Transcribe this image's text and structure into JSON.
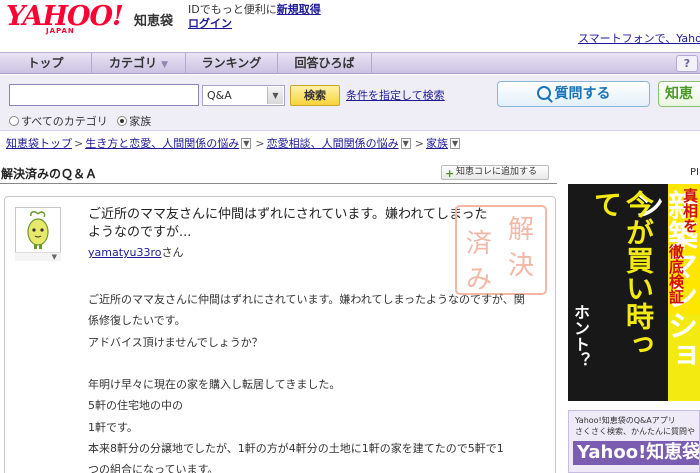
{
  "header": {
    "logo_text": "YAHOO!",
    "logo_sub": "JAPAN",
    "service_name": "知恵袋",
    "id_promo": "IDでもっと便利に",
    "register_link": "新規取得",
    "login_link": "ログイン",
    "smartphone_link": "スマートフォンで、Yahoo!知"
  },
  "nav": {
    "items": [
      {
        "label": "トップ",
        "has_arrow": false
      },
      {
        "label": "カテゴリ",
        "has_arrow": true
      },
      {
        "label": "ランキング",
        "has_arrow": false
      },
      {
        "label": "回答ひろば",
        "has_arrow": false
      }
    ],
    "help_label": "?"
  },
  "search": {
    "query": "",
    "select_value": "Q&A",
    "button_label": "検索",
    "advanced_link": "条件を指定して検索",
    "radio_all": "すべてのカテゴリ",
    "radio_category": "家族",
    "selected_radio": "家族",
    "ask_button": "質問する",
    "chie_button": "知恵"
  },
  "breadcrumb": {
    "items": [
      "知恵袋トップ",
      "生き方と恋愛、人間関係の悩み",
      "恋愛相談、人間関係の悩み",
      "家族"
    ]
  },
  "section": {
    "title": "解決済みのＱ＆Ａ",
    "add_button": "知恵コレに追加する"
  },
  "question": {
    "title": "ご近所のママ友さんに仲間はずれにされています。嫌われてしまったようなのですが...",
    "username": "yamatyu33ro",
    "username_suffix": "さん",
    "stamp_text": "解決済み",
    "body": [
      "ご近所のママ友さんに仲間はずれにされています。嫌われてしまったようなのですが、関",
      "係修復したいです。",
      "アドバイス頂けませんでしょうか？",
      "",
      "年明け早々に現在の家を購入し転居してきました。",
      "5軒の住宅地の中の",
      "1軒です。",
      "本来8軒分の分譲地でしたが、1軒の方が4軒分の土地に1軒の家を建てたので5軒で1",
      "つの組合になっています。"
    ]
  },
  "ads": {
    "pr_label": "PI",
    "top_lines": [
      "新築マンション",
      "今が買い時って",
      "ホント？"
    ],
    "top_side": [
      "真相を",
      "徹底検証"
    ],
    "bottom_small_1": "Yahoo!知恵袋のQ&Aアプリ",
    "bottom_small_2": "さくさく検索、かんたんに質問や",
    "bottom_brand": "Yahoo!知恵袋"
  },
  "colors": {
    "link": "#1d1b99",
    "logo_red": "#ff0033",
    "nav_bg": "#cbc2e2",
    "search_button": "#f7d33a",
    "ask_blue": "#1a75bb",
    "stamp_red": "#f0a08a"
  }
}
